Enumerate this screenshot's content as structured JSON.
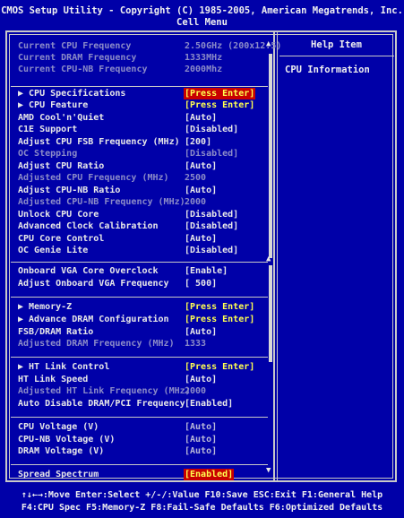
{
  "title": {
    "line1": "CMOS Setup Utility - Copyright (C) 1985-2005, American Megatrends, Inc.",
    "line2": "Cell Menu"
  },
  "help": {
    "title": "Help Item",
    "text": "CPU Information"
  },
  "items": [
    {
      "label": "Current CPU Frequency",
      "value": "2.50GHz (200x12.5)",
      "style": "dim"
    },
    {
      "label": "Current DRAM Frequency",
      "value": "1333MHz",
      "style": "dim"
    },
    {
      "label": "Current CPU-NB Frequency",
      "value": "2000Mhz",
      "style": "dim"
    },
    {
      "label": "▶ CPU Specifications",
      "value": "[Press Enter]",
      "style": "sub-hl"
    },
    {
      "label": "▶ CPU Feature",
      "value": "[Press Enter]",
      "style": "sub"
    },
    {
      "label": "AMD Cool'n'Quiet",
      "value": "[Auto]",
      "style": "normal"
    },
    {
      "label": "C1E Support",
      "value": "[Disabled]",
      "style": "normal"
    },
    {
      "label": "Adjust CPU FSB Frequency (MHz)",
      "value": "[200]",
      "style": "normal"
    },
    {
      "label": "OC Stepping",
      "value": "[Disabled]",
      "style": "dim"
    },
    {
      "label": "Adjust CPU Ratio",
      "value": "[Auto]",
      "style": "normal"
    },
    {
      "label": "Adjusted CPU Frequency (MHz)",
      "value": "2500",
      "style": "dim"
    },
    {
      "label": "Adjust CPU-NB Ratio",
      "value": "[Auto]",
      "style": "normal"
    },
    {
      "label": "Adjusted CPU-NB Frequency (MHz)",
      "value": "2000",
      "style": "dim"
    },
    {
      "label": "Unlock CPU Core",
      "value": "[Disabled]",
      "style": "normal"
    },
    {
      "label": "Advanced Clock Calibration",
      "value": "[Disabled]",
      "style": "normal"
    },
    {
      "label": "CPU Core Control",
      "value": "[Auto]",
      "style": "normal"
    },
    {
      "label": "OC Genie Lite",
      "value": "[Disabled]",
      "style": "normal"
    },
    {
      "label": "Onboard VGA Core Overclock",
      "value": "[Enable]",
      "style": "normal"
    },
    {
      "label": "Adjust Onboard VGA Frequency",
      "value": "[ 500]",
      "style": "normal"
    },
    {
      "label": "▶ Memory-Z",
      "value": "[Press Enter]",
      "style": "sub"
    },
    {
      "label": "▶ Advance DRAM Configuration",
      "value": "[Press Enter]",
      "style": "sub"
    },
    {
      "label": "FSB/DRAM Ratio",
      "value": "[Auto]",
      "style": "normal"
    },
    {
      "label": "Adjusted DRAM Frequency (MHz)",
      "value": "1333",
      "style": "dim"
    },
    {
      "label": "▶ HT Link Control",
      "value": "[Press Enter]",
      "style": "sub"
    },
    {
      "label": "HT Link Speed",
      "value": "[Auto]",
      "style": "normal"
    },
    {
      "label": "Adjusted HT Link Frequency (MHz)",
      "value": "2000",
      "style": "dim"
    },
    {
      "label": "Auto Disable DRAM/PCI Frequency",
      "value": "[Enabled]",
      "style": "normal"
    },
    {
      "label": "CPU Voltage (V)",
      "value": "[Auto]",
      "style": "normal-dimval"
    },
    {
      "label": "CPU-NB Voltage (V)",
      "value": "[Auto]",
      "style": "normal-dimval"
    },
    {
      "label": "DRAM Voltage (V)",
      "value": "[Auto]",
      "style": "normal-dimval"
    },
    {
      "label": "Spread Spectrum",
      "value": "[Enabled]",
      "style": "hl"
    }
  ],
  "footer": {
    "line1": "↑↓←→:Move  Enter:Select  +/-/:Value  F10:Save  ESC:Exit  F1:General Help",
    "line2": "F4:CPU Spec  F5:Memory-Z  F8:Fail-Safe Defaults    F6:Optimized Defaults"
  },
  "colors": {
    "background": "#0000a8",
    "highlight": "#c80000",
    "submenu_value": "#ffff50",
    "dim_text": "#8c8cc8"
  }
}
